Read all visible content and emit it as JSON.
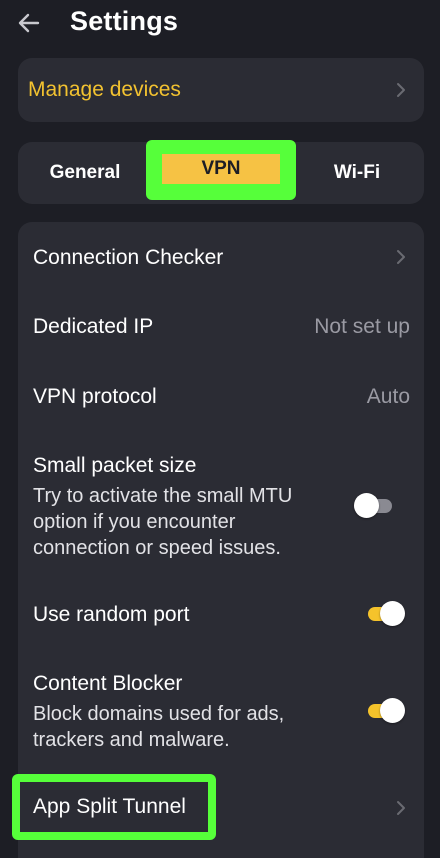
{
  "header": {
    "title": "Settings",
    "back_icon": "arrow-left-icon"
  },
  "manage_devices": {
    "label": "Manage devices",
    "color": "#f2c230"
  },
  "tabs": [
    {
      "label": "General",
      "selected": false
    },
    {
      "label": "VPN",
      "selected": true
    },
    {
      "label": "Wi-Fi",
      "selected": false
    }
  ],
  "settings": {
    "connection_checker": {
      "title": "Connection Checker"
    },
    "dedicated_ip": {
      "title": "Dedicated IP",
      "value": "Not set up"
    },
    "vpn_protocol": {
      "title": "VPN protocol",
      "value": "Auto"
    },
    "small_packet": {
      "title": "Small packet size",
      "description": "Try to activate the small MTU option if you encounter connection or speed issues.",
      "enabled": false
    },
    "random_port": {
      "title": "Use random port",
      "enabled": true
    },
    "content_blocker": {
      "title": "Content Blocker",
      "description": "Block domains used for ads, trackers and malware.",
      "enabled": true
    },
    "app_split_tunnel": {
      "title": "App Split Tunnel"
    }
  },
  "colors": {
    "accent": "#f5c32b",
    "highlight": "#56ff3a",
    "card": "#2b2c34",
    "background": "#1d1e25"
  }
}
